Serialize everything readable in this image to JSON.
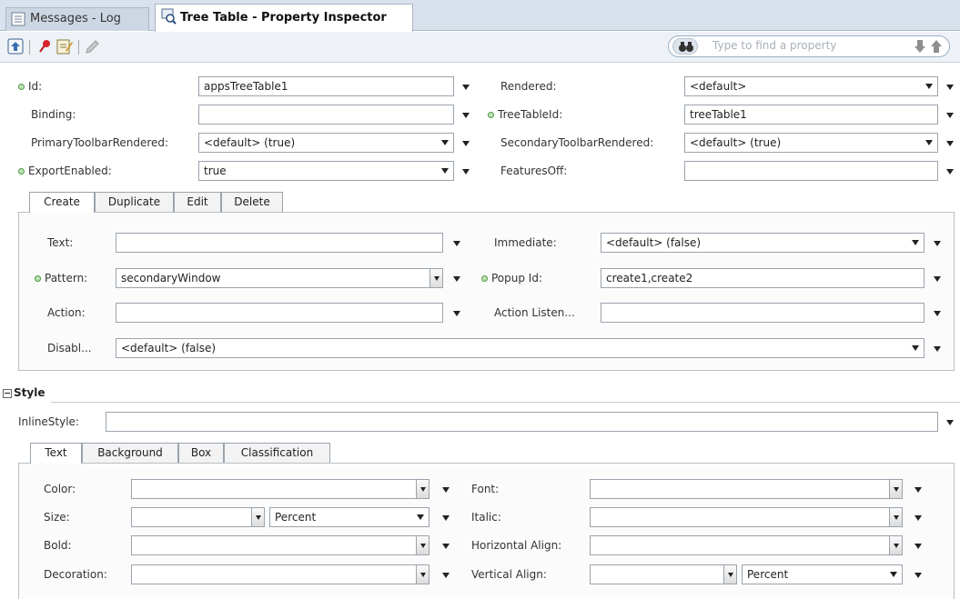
{
  "window_tabs": [
    {
      "label": "Messages - Log"
    },
    {
      "label": "Tree Table - Property Inspector"
    }
  ],
  "toolbar": {
    "search_placeholder": "Type to find a property"
  },
  "props": {
    "id": {
      "label": "Id:",
      "value": "appsTreeTable1"
    },
    "rendered": {
      "label": "Rendered:",
      "value": "<default>"
    },
    "binding": {
      "label": "Binding:",
      "value": ""
    },
    "treetableid": {
      "label": "TreeTableId:",
      "value": "treeTable1"
    },
    "primary_toolbar": {
      "label": "PrimaryToolbarRendered:",
      "value": "<default> (true)"
    },
    "secondary_toolbar": {
      "label": "SecondaryToolbarRendered:",
      "value": "<default> (true)"
    },
    "export_enabled": {
      "label": "ExportEnabled:",
      "value": "true"
    },
    "features_off": {
      "label": "FeaturesOff:",
      "value": ""
    }
  },
  "action_tabs": [
    "Create",
    "Duplicate",
    "Edit",
    "Delete"
  ],
  "create": {
    "text": {
      "label": "Text:",
      "value": ""
    },
    "immediate": {
      "label": "Immediate:",
      "value": "<default> (false)"
    },
    "pattern": {
      "label": "Pattern:",
      "value": "secondaryWindow"
    },
    "popup_id": {
      "label": "Popup Id:",
      "value": "create1,create2"
    },
    "action": {
      "label": "Action:",
      "value": ""
    },
    "action_listener": {
      "label": "Action Listen...",
      "value": ""
    },
    "disabled": {
      "label": "Disabl...",
      "value": "<default> (false)"
    }
  },
  "style": {
    "header": "Style",
    "inline_style": {
      "label": "InlineStyle:",
      "value": ""
    },
    "tabs": [
      "Text",
      "Background",
      "Box",
      "Classification"
    ],
    "color": {
      "label": "Color:",
      "value": ""
    },
    "font": {
      "label": "Font:",
      "value": ""
    },
    "size": {
      "label": "Size:",
      "value": "",
      "unit": "Percent"
    },
    "italic": {
      "label": "Italic:",
      "value": ""
    },
    "bold": {
      "label": "Bold:",
      "value": ""
    },
    "horizontal_align": {
      "label": "Horizontal Align:",
      "value": ""
    },
    "decoration": {
      "label": "Decoration:",
      "value": ""
    },
    "vertical_align": {
      "label": "Vertical Align:",
      "value": "",
      "unit": "Percent"
    }
  }
}
